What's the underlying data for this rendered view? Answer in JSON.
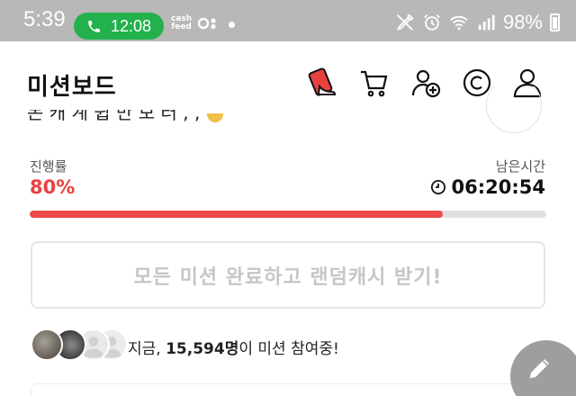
{
  "status_bar": {
    "time": "5:39",
    "call_duration": "12:08",
    "cashfeed_line1": "cash",
    "cashfeed_line2": "feed",
    "battery": "98%"
  },
  "header": {
    "title": "미션보드",
    "icons": [
      "shoe-card-icon",
      "cart-icon",
      "add-user-icon",
      "coin-icon",
      "profile-icon"
    ]
  },
  "partial_text": "돈 캐 계 쉽 만 보 러 ,  ,",
  "progress": {
    "label": "진행률",
    "value_text": "80%",
    "value": 0.8,
    "time_label": "남은시간",
    "time_value": "06:20:54"
  },
  "claim_button": {
    "label": "모든 미션 완료하고 랜덤캐시 받기!"
  },
  "participants": {
    "prefix": "지금, ",
    "count": "15,594명",
    "suffix": "이 미션 참여중!"
  },
  "colors": {
    "accent": "#ee4a4a",
    "call_pill": "#22b14c",
    "status_bar": "#b8b8b8",
    "disabled_text": "#c6c6c6"
  }
}
